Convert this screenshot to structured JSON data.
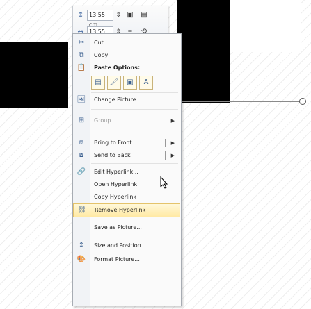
{
  "toolbar": {
    "height_value": "13.55 cm",
    "width_value": "13.55 cm"
  },
  "menu": {
    "cut": "Cut",
    "copy": "Copy",
    "paste_options": "Paste Options:",
    "change_picture": "Change Picture...",
    "group": "Group",
    "bring_to_front": "Bring to Front",
    "send_to_back": "Send to Back",
    "edit_hyperlink": "Edit Hyperlink...",
    "open_hyperlink": "Open Hyperlink",
    "copy_hyperlink": "Copy Hyperlink",
    "remove_hyperlink": "Remove Hyperlink",
    "save_as_picture": "Save as Picture...",
    "size_and_position": "Size and Position...",
    "format_picture": "Format Picture..."
  },
  "paste_buttons": [
    "paste-use-destination",
    "paste-keep-source",
    "paste-picture",
    "paste-keep-text"
  ]
}
